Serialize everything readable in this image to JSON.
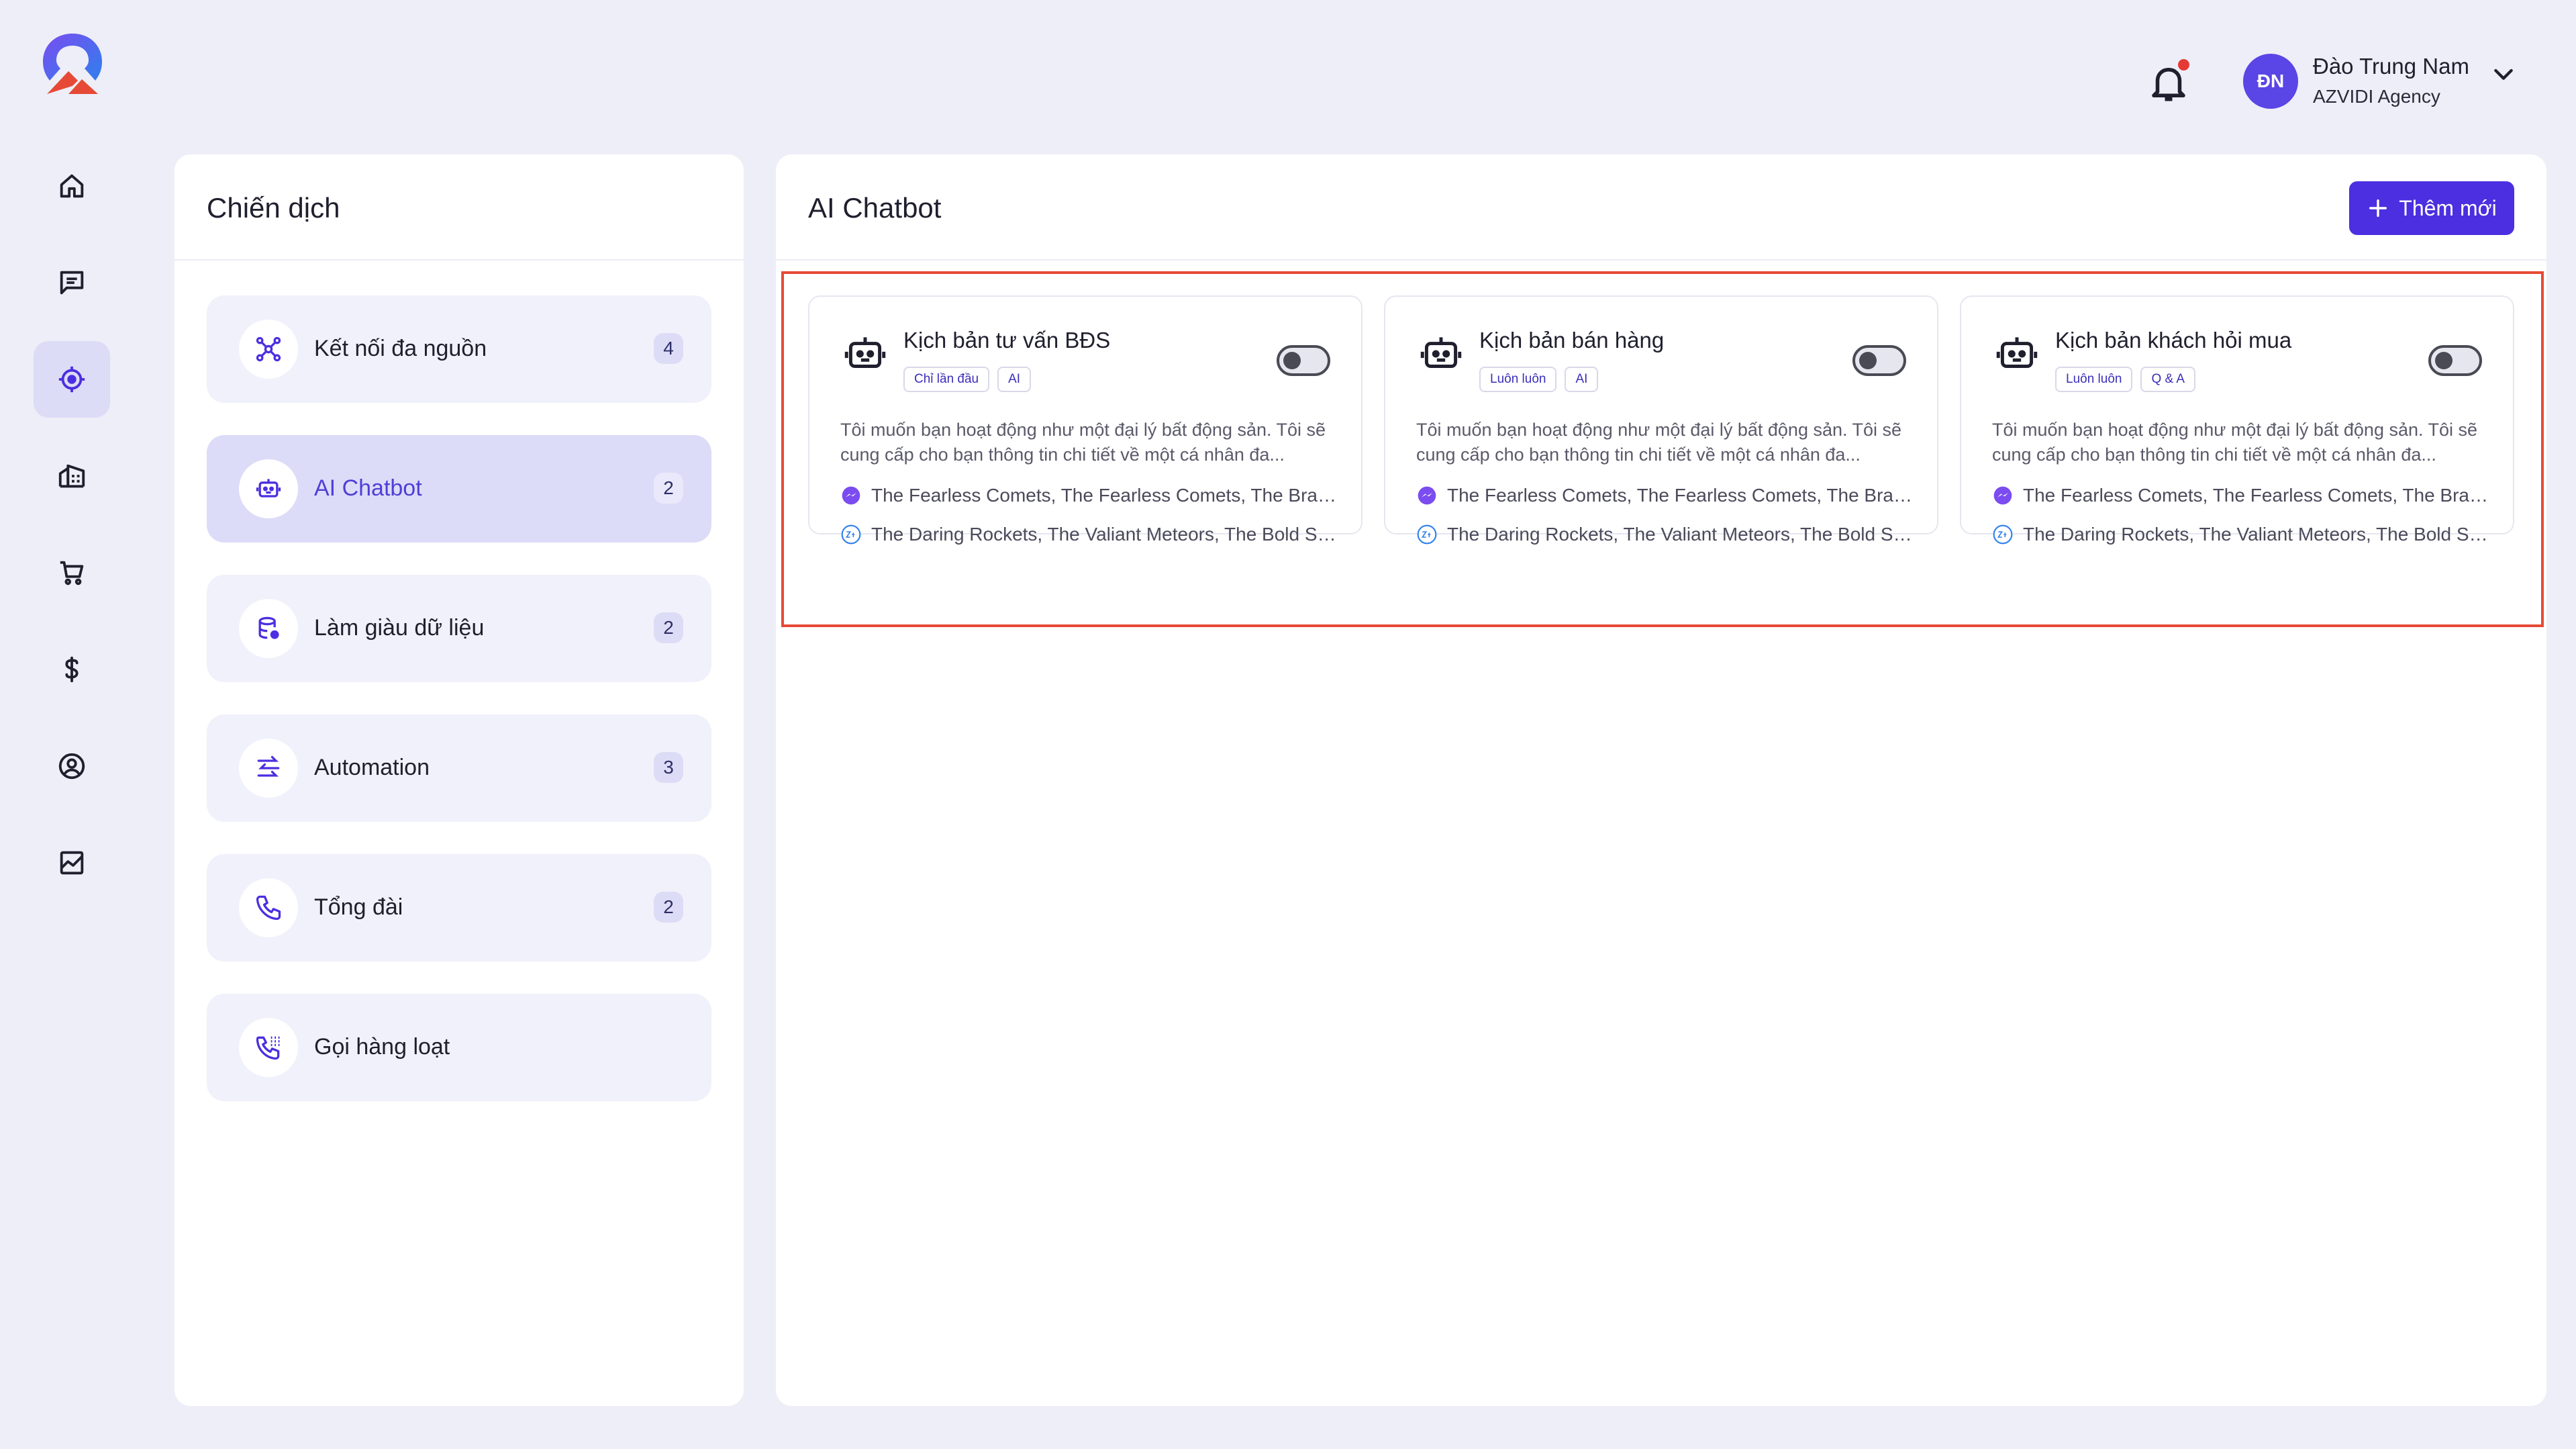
{
  "colors": {
    "accent": "#4b2fe0",
    "background": "#eeeef8",
    "highlight": "#e64a36",
    "notification_dot": "#e53935"
  },
  "rail": {
    "items": [
      {
        "icon": "home-icon"
      },
      {
        "icon": "chat-icon"
      },
      {
        "icon": "target-icon",
        "active": true
      },
      {
        "icon": "building-icon"
      },
      {
        "icon": "cart-icon"
      },
      {
        "icon": "dollar-icon"
      },
      {
        "icon": "user-circle-icon"
      },
      {
        "icon": "chart-icon"
      }
    ]
  },
  "header": {
    "user": {
      "initials": "ĐN",
      "name": "Đào Trung Nam",
      "org": "AZVIDI Agency"
    }
  },
  "campaigns": {
    "title": "Chiến dịch",
    "items": [
      {
        "label": "Kết nối đa nguồn",
        "count": "4",
        "icon": "hub-icon"
      },
      {
        "label": "AI Chatbot",
        "count": "2",
        "icon": "robot-icon",
        "active": true
      },
      {
        "label": "Làm giàu dữ liệu",
        "count": "2",
        "icon": "database-icon"
      },
      {
        "label": "Automation",
        "count": "3",
        "icon": "automation-icon"
      },
      {
        "label": "Tổng đài",
        "count": "2",
        "icon": "phone-icon"
      },
      {
        "label": "Gọi hàng loạt",
        "count": "",
        "icon": "bulk-call-icon"
      }
    ]
  },
  "main": {
    "title": "AI Chatbot",
    "add_button_label": "Thêm mới",
    "cards": [
      {
        "title": "Kịch bản tư vấn BĐS",
        "tags": [
          "Chỉ lần đầu",
          "AI"
        ],
        "enabled": false,
        "description": "Tôi muốn bạn hoạt động như một đại lý bất động sản. Tôi sẽ cung cấp cho bạn thông tin chi tiết về một cá nhân đa...",
        "messenger": "The Fearless Comets, The Fearless Comets, The Brav...",
        "zalo": "The Daring Rockets, The Valiant Meteors, The Bold Sa..."
      },
      {
        "title": "Kịch bản bán hàng",
        "tags": [
          "Luôn luôn",
          "AI"
        ],
        "enabled": false,
        "description": "Tôi muốn bạn hoạt động như một đại lý bất động sản. Tôi sẽ cung cấp cho bạn thông tin chi tiết về một cá nhân đa...",
        "messenger": "The Fearless Comets, The Fearless Comets, The Brav...",
        "zalo": "The Daring Rockets, The Valiant Meteors, The Bold Sa..."
      },
      {
        "title": "Kịch bản khách hỏi mua",
        "tags": [
          "Luôn luôn",
          "Q & A"
        ],
        "enabled": false,
        "description": "Tôi muốn bạn hoạt động như một đại lý bất động sản. Tôi sẽ cung cấp cho bạn thông tin chi tiết về một cá nhân đa...",
        "messenger": "The Fearless Comets, The Fearless Comets, The Brav...",
        "zalo": "The Daring Rockets, The Valiant Meteors, The Bold Sa..."
      }
    ]
  }
}
